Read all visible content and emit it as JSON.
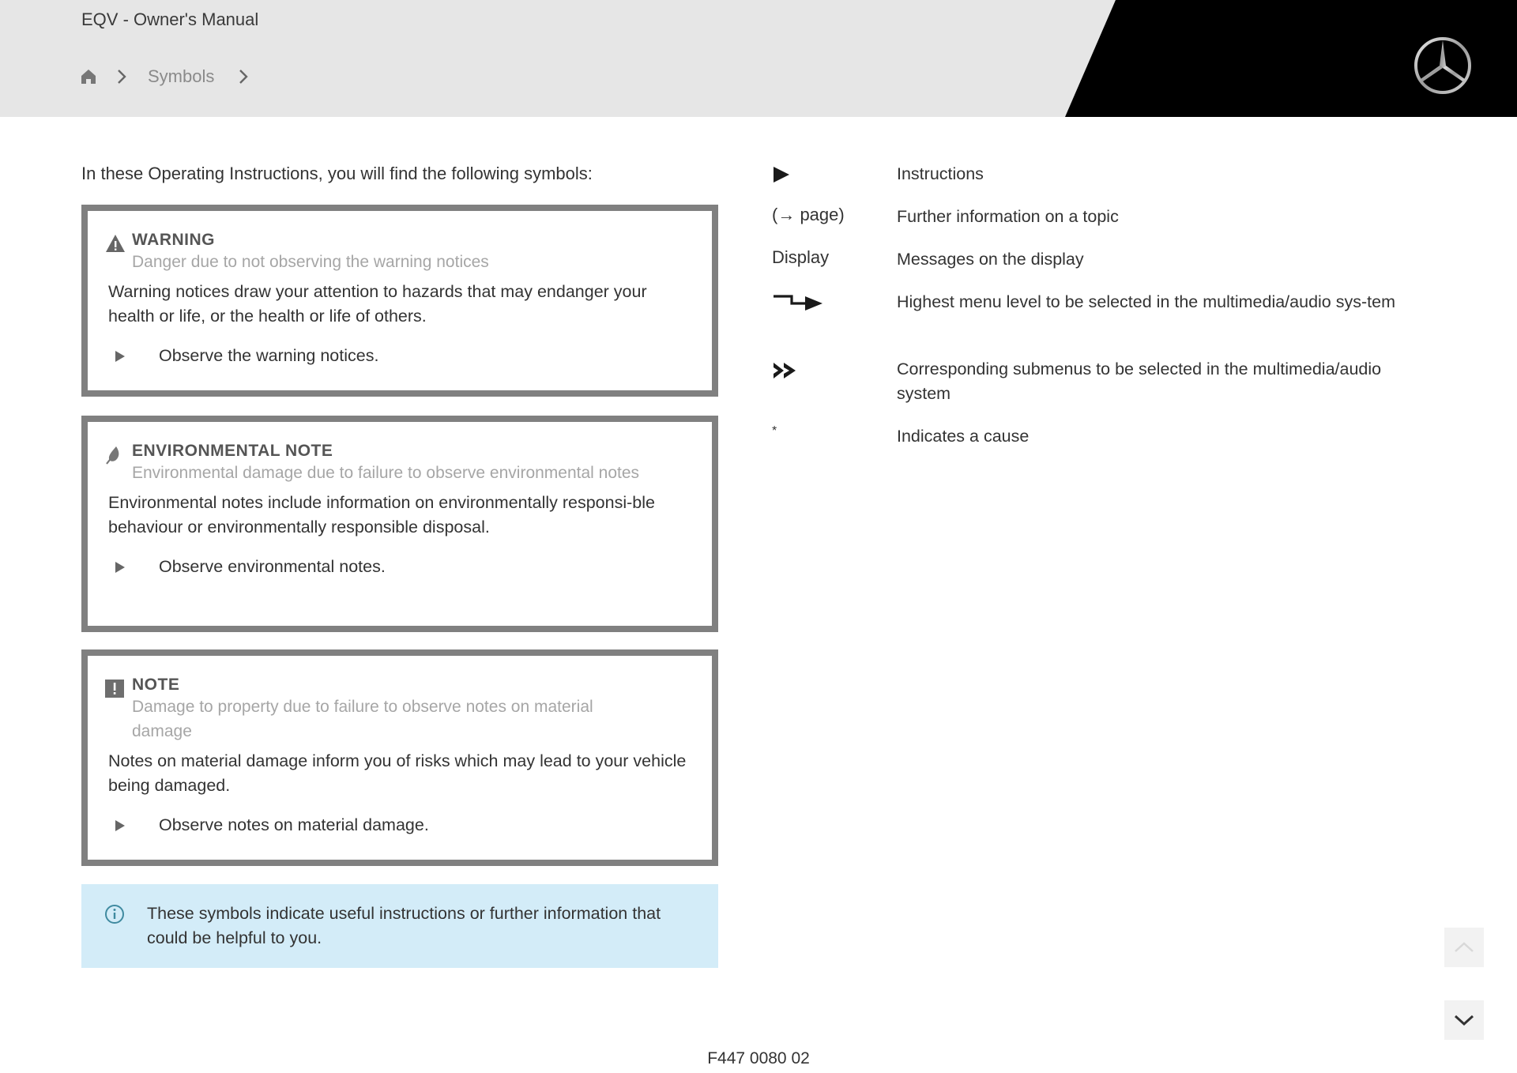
{
  "header": {
    "app_title": "EQV - Owner's Manual",
    "breadcrumb": {
      "home_icon": "home-icon",
      "items": [
        "Symbols"
      ],
      "separator_icon": "chevron-right-icon"
    },
    "logo": "mercedes-star-logo"
  },
  "intro": "In these Operating Instructions, you will find the following symbols:",
  "notices": [
    {
      "type": "warning",
      "icon": "warning-triangle-icon",
      "title": "WARNING",
      "subtitle": "Danger due to not observing the warning notices",
      "body": "Warning notices draw your attention to hazards that may endanger your health or life, or the health or life of others.",
      "step": "Observe the warning notices."
    },
    {
      "type": "environmental",
      "icon": "leaf-icon",
      "title": "ENVIRONMENTAL NOTE",
      "subtitle": "Environmental damage due to failure to observe environmental notes",
      "body": "Environmental notes include information on environmentally responsi-ble behaviour or environmentally responsible disposal.",
      "step": "Observe environmental notes."
    },
    {
      "type": "note",
      "icon": "exclamation-box-icon",
      "title": "NOTE",
      "subtitle": "Damage to property due to failure to observe notes on material damage",
      "body": "Notes on material damage inform you of risks which may lead to your vehicle being damaged.",
      "step": "Observe notes on material damage."
    }
  ],
  "info_box": {
    "icon": "info-circle-icon",
    "text": "These symbols indicate useful instructions or further information that could be helpful to you."
  },
  "legend": [
    {
      "symbol_icon": "triangle-right-icon",
      "symbol_text": "",
      "description": "Instructions"
    },
    {
      "symbol_icon": "",
      "symbol_text": "(→ page)",
      "description": "Further information on a topic"
    },
    {
      "symbol_icon": "",
      "symbol_text": "Display",
      "description": "Messages on the display"
    },
    {
      "symbol_icon": "step-arrow-icon",
      "symbol_text": "",
      "description": "Highest menu level to be selected in the multimedia/audio sys-tem"
    },
    {
      "symbol_icon": "double-chevron-icon",
      "symbol_text": "",
      "description": "Corresponding submenus to be selected in the multimedia/audio system"
    },
    {
      "symbol_icon": "",
      "symbol_text": "*",
      "description": "Indicates a cause"
    }
  ],
  "colors": {
    "header_bg": "#e6e6e6",
    "header_black": "#000000",
    "notice_border": "#808080",
    "info_bg": "#d3ecf8",
    "display_link": "#1f8fae",
    "subtitle_gray": "#a6a6a6"
  },
  "navigation": {
    "scroll_up": "scroll-up-button",
    "scroll_down": "scroll-down-button"
  },
  "footer": {
    "code": "F447 0080 02"
  }
}
